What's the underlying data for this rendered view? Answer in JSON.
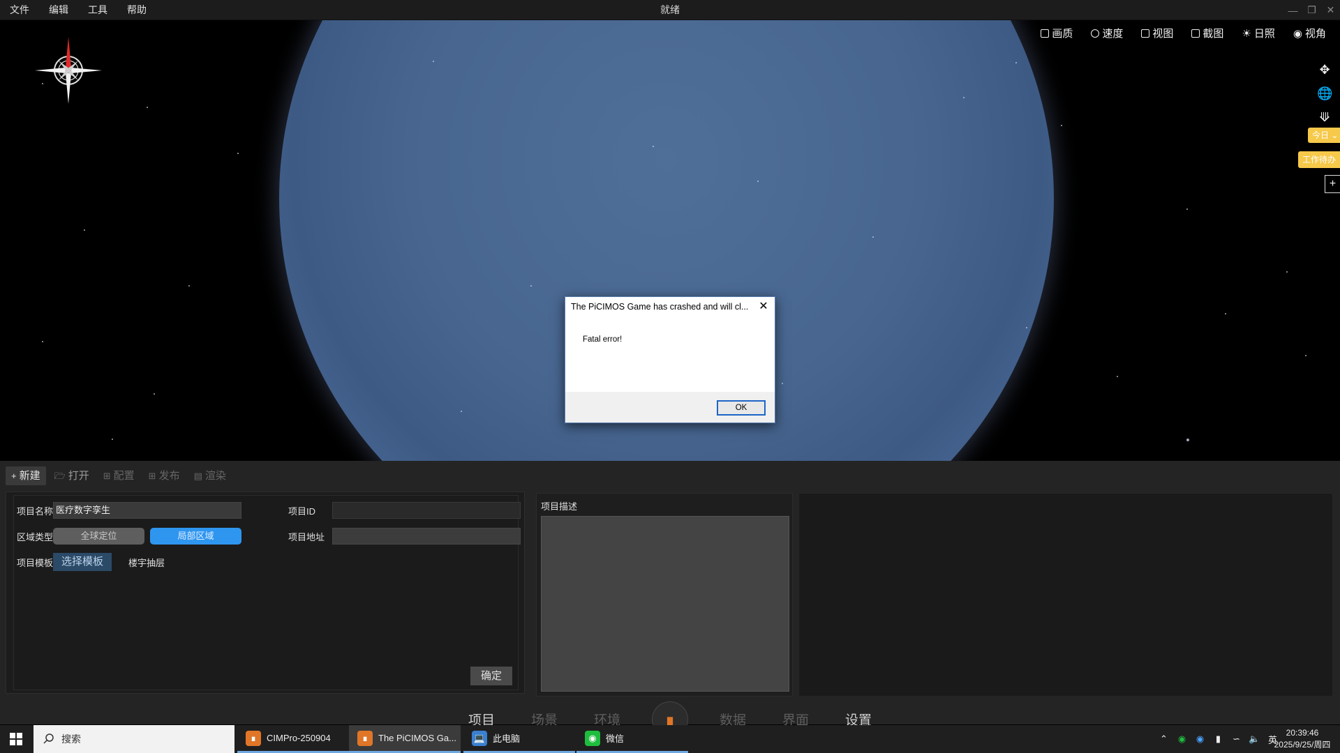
{
  "menu": [
    "文件",
    "编辑",
    "工具",
    "帮助"
  ],
  "window_title": "就绪",
  "toolbar": {
    "quality": "画质",
    "speed": "速度",
    "view": "视图",
    "screenshot": "截图",
    "sunlight": "日照",
    "angle": "视角"
  },
  "side_tags": {
    "today": "今日",
    "todo": "工作待办"
  },
  "dialog": {
    "title": "The PiCIMOS Game has crashed and will cl...",
    "message": "Fatal error!",
    "ok": "OK"
  },
  "panel": {
    "tabs": [
      "新建",
      "打开",
      "配置",
      "发布",
      "渲染"
    ],
    "form": {
      "name_label": "项目名称",
      "name_value": "医疗数字孪生",
      "id_label": "项目ID",
      "id_value": "",
      "region_label": "区域类型",
      "region_global": "全球定位",
      "region_local": "局部区域",
      "address_label": "项目地址",
      "address_value": "",
      "template_label": "项目模板",
      "template_button": "选择模板",
      "template_value": "楼宇抽层",
      "confirm": "确定"
    },
    "description_label": "项目描述"
  },
  "bottom_tabs": [
    "项目",
    "场景",
    "环境",
    "数据",
    "界面",
    "设置"
  ],
  "taskbar": {
    "search_placeholder": "搜索",
    "tasks": [
      "CIMPro-250904",
      "The PiCIMOS Ga...",
      "此电脑",
      "微信"
    ],
    "ime": "英",
    "time": "20:39:46",
    "date": "2025/9/25/周四"
  },
  "colors": {
    "accent_blue": "#2f96f0",
    "tag_yellow": "#f6c94a",
    "logo_orange": "#e07628",
    "planet_blue": "#47658f"
  }
}
